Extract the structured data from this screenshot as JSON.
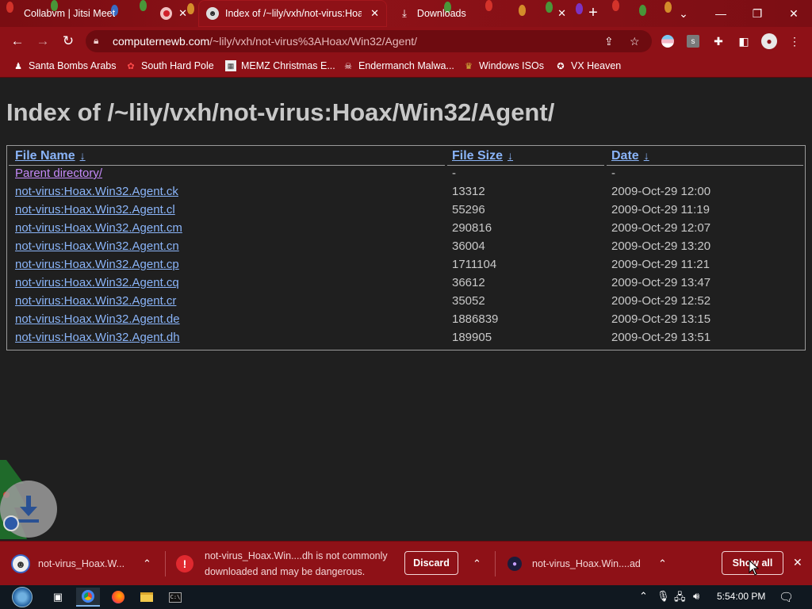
{
  "tabs": [
    {
      "title": "Collabvm | Jitsi Meet",
      "icon": "recording-dot-icon"
    },
    {
      "title": "Index of /~lily/vxh/not-virus:Hoa",
      "icon": "site-favicon-icon"
    },
    {
      "title": "Downloads",
      "icon": "download-icon"
    }
  ],
  "toolbar": {
    "url_host": "computernewb.com",
    "url_path": "/~lily/vxh/not-virus%3AHoax/Win32/Agent/"
  },
  "bookmarks": [
    {
      "label": "Santa Bombs Arabs",
      "icon": "santa-icon"
    },
    {
      "label": "South Hard Pole",
      "icon": "flower-icon"
    },
    {
      "label": "MEMZ Christmas E...",
      "icon": "memz-icon"
    },
    {
      "label": "Endermanch Malwa...",
      "icon": "skull-icon"
    },
    {
      "label": "Windows ISOs",
      "icon": "windows-iso-icon"
    },
    {
      "label": "VX Heaven",
      "icon": "vx-heaven-icon"
    }
  ],
  "page": {
    "title": "Index of /~lily/vxh/not-virus:Hoax/Win32/Agent/",
    "columns": {
      "name": "File Name",
      "size": "File Size",
      "date": "Date",
      "sort_arrow": "↓"
    },
    "parent": {
      "name": "Parent directory/",
      "size": "-",
      "date": "-"
    },
    "rows": [
      {
        "name": "not-virus:Hoax.Win32.Agent.ck",
        "size": "13312",
        "date": "2009-Oct-29 12:00"
      },
      {
        "name": "not-virus:Hoax.Win32.Agent.cl",
        "size": "55296",
        "date": "2009-Oct-29 11:19"
      },
      {
        "name": "not-virus:Hoax.Win32.Agent.cm",
        "size": "290816",
        "date": "2009-Oct-29 12:07"
      },
      {
        "name": "not-virus:Hoax.Win32.Agent.cn",
        "size": "36004",
        "date": "2009-Oct-29 13:20"
      },
      {
        "name": "not-virus:Hoax.Win32.Agent.cp",
        "size": "1711104",
        "date": "2009-Oct-29 11:21"
      },
      {
        "name": "not-virus:Hoax.Win32.Agent.cq",
        "size": "36612",
        "date": "2009-Oct-29 13:47"
      },
      {
        "name": "not-virus:Hoax.Win32.Agent.cr",
        "size": "35052",
        "date": "2009-Oct-29 12:52"
      },
      {
        "name": "not-virus:Hoax.Win32.Agent.de",
        "size": "1886839",
        "date": "2009-Oct-29 13:15"
      },
      {
        "name": "not-virus:Hoax.Win32.Agent.dh",
        "size": "189905",
        "date": "2009-Oct-29 13:51"
      }
    ]
  },
  "downloads": {
    "item1": "not-virus_Hoax.W...",
    "warning_line1": "not-virus_Hoax.Win....dh is not commonly",
    "warning_line2": "downloaded and may be dangerous.",
    "discard_label": "Discard",
    "item3": "not-virus_Hoax.Win....ad",
    "show_all_label": "Show all"
  },
  "taskbar": {
    "clock": "5:54:00 PM"
  },
  "colors": {
    "theme": "#8e1117",
    "link": "#8ab4f8",
    "visited": "#c58af9",
    "page_bg": "#1f1f1f"
  }
}
